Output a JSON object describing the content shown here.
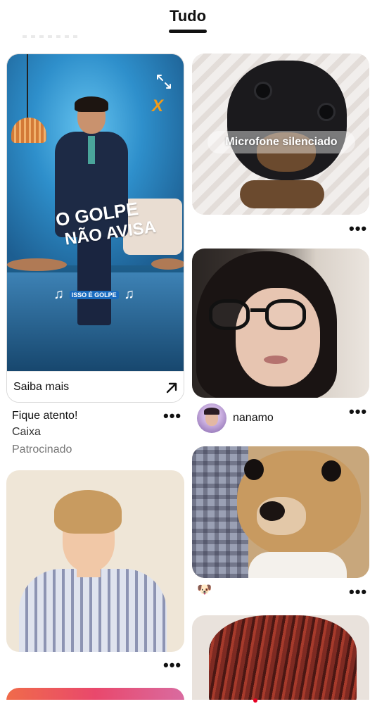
{
  "header": {
    "tab_label": "Tudo"
  },
  "ad_pin": {
    "headline_line1": "O GOLPE",
    "headline_line2": "NÃO AVISA",
    "audio_tag_left": "♫",
    "audio_tag_pill": "ISSO É GOLPE",
    "audio_tag_right": "♫",
    "brand_logo": "X",
    "cta_label": "Saiba mais",
    "title": "Fique atento!",
    "advertiser": "Caixa",
    "sponsored_label": "Patrocinado",
    "more_label": "•••"
  },
  "pins_left": [
    {
      "more_label": "•••"
    }
  ],
  "pins_right": [
    {
      "overlay_text": "Microfone silenciado",
      "more_label": "•••"
    },
    {
      "pinner_name": "nanamo",
      "more_label": "•••"
    },
    {
      "emoji": "🐶",
      "more_label": "•••"
    }
  ],
  "icons": {
    "expand": "expand-icon",
    "cta_arrow": "arrow-up-right-icon",
    "more": "more-options-icon"
  },
  "colors": {
    "brand_red": "#e60023",
    "text_primary": "#111111",
    "text_muted": "#777777"
  }
}
